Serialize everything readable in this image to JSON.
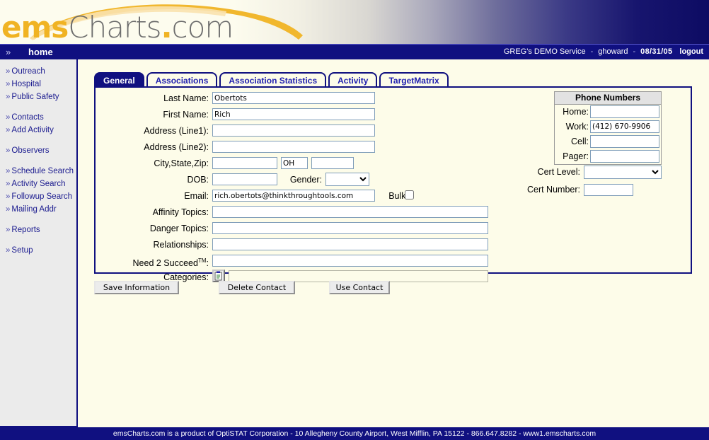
{
  "brand": {
    "logo_ems": "ems",
    "logo_charts": "Charts",
    "logo_dot": ".",
    "logo_com": "com",
    "accent_gold": "#f0b323",
    "accent_navy": "#101080",
    "page_bg": "#fdfce9"
  },
  "navbar": {
    "chevron": "chevron-right-icon",
    "chevron_glyph": "»",
    "home_label": "home",
    "service": "GREG's DEMO Service",
    "sep1": "-",
    "user": "ghoward",
    "sep2": "-",
    "date": "08/31/05",
    "logout_label": "logout"
  },
  "sidebar": {
    "groups": [
      {
        "items": [
          {
            "label": "Outreach",
            "name": "sidebar-item-outreach"
          },
          {
            "label": "Hospital",
            "name": "sidebar-item-hospital"
          },
          {
            "label": "Public Safety",
            "name": "sidebar-item-public-safety"
          }
        ]
      },
      {
        "items": [
          {
            "label": "Contacts",
            "name": "sidebar-item-contacts"
          },
          {
            "label": "Add Activity",
            "name": "sidebar-item-add-activity"
          }
        ]
      },
      {
        "items": [
          {
            "label": "Observers",
            "name": "sidebar-item-observers"
          }
        ]
      },
      {
        "items": [
          {
            "label": "Schedule Search",
            "name": "sidebar-item-schedule-search"
          },
          {
            "label": "Activity Search",
            "name": "sidebar-item-activity-search"
          },
          {
            "label": "Followup Search",
            "name": "sidebar-item-followup-search"
          },
          {
            "label": "Mailing Addr",
            "name": "sidebar-item-mailing-addr"
          }
        ]
      },
      {
        "items": [
          {
            "label": "Reports",
            "name": "sidebar-item-reports"
          }
        ]
      },
      {
        "items": [
          {
            "label": "Setup",
            "name": "sidebar-item-setup"
          }
        ]
      }
    ],
    "bullet": "»"
  },
  "tabs": [
    {
      "label": "General",
      "active": true
    },
    {
      "label": "Associations",
      "active": false
    },
    {
      "label": "Association Statistics",
      "active": false
    },
    {
      "label": "Activity",
      "active": false
    },
    {
      "label": "TargetMatrix",
      "active": false
    }
  ],
  "form": {
    "last_name": {
      "label": "Last Name:",
      "value": "Obertots"
    },
    "first_name": {
      "label": "First Name:",
      "value": "Rich"
    },
    "address1": {
      "label": "Address (Line1):",
      "value": ""
    },
    "address2": {
      "label": "Address (Line2):",
      "value": ""
    },
    "city_state_zip": {
      "label": "City,State,Zip:",
      "city": "",
      "state": "OH",
      "zip": ""
    },
    "dob": {
      "label": "DOB:",
      "value": ""
    },
    "gender": {
      "label": "Gender:",
      "value": ""
    },
    "email": {
      "label": "Email:",
      "value": "rich.obertots@thinkthroughtools.com"
    },
    "bulk": {
      "label": "Bulk:",
      "checked": false
    },
    "affinity_topics": {
      "label": "Affinity Topics:",
      "value": ""
    },
    "danger_topics": {
      "label": "Danger Topics:",
      "value": ""
    },
    "relationships": {
      "label": "Relationships:",
      "value": ""
    },
    "need2succeed": {
      "label": "Need 2 Succeed",
      "trademark": "TM",
      "suffix": ":",
      "value": ""
    },
    "categories": {
      "label": "Categories:",
      "value": "",
      "picker_icon": "clipboard-picker-icon"
    }
  },
  "phone_panel": {
    "title": "Phone Numbers",
    "rows": [
      {
        "label": "Home:",
        "value": ""
      },
      {
        "label": "Work:",
        "value": "(412) 670-9906"
      },
      {
        "label": "Cell:",
        "value": ""
      },
      {
        "label": "Pager:",
        "value": ""
      }
    ]
  },
  "cert": {
    "level": {
      "label": "Cert Level:",
      "value": ""
    },
    "number": {
      "label": "Cert Number:",
      "value": ""
    }
  },
  "actions": [
    {
      "label": "Save Information",
      "name": "save-information-button"
    },
    {
      "label": "Delete Contact",
      "name": "delete-contact-button"
    },
    {
      "label": "Use Contact",
      "name": "use-contact-button"
    }
  ],
  "footer": {
    "text": "emsCharts.com is a product of OptiSTAT Corporation - 10 Allegheny County Airport, West Mifflin, PA 15122 - 866.647.8282 - www1.emscharts.com"
  }
}
